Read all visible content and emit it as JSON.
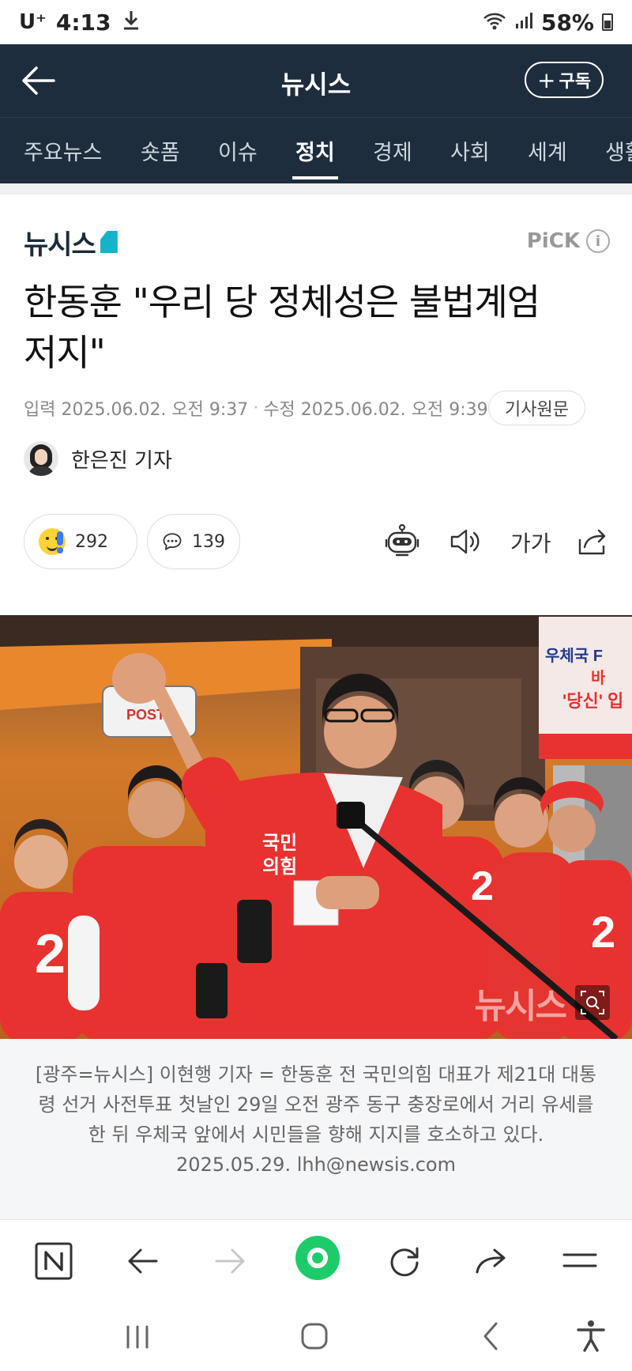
{
  "status": {
    "carrier": "U⁺",
    "time": "4:13",
    "battery": "58%"
  },
  "header": {
    "title": "뉴시스",
    "subscribe_label": "구독"
  },
  "tabs": [
    {
      "label": "주요뉴스",
      "active": false
    },
    {
      "label": "숏폼",
      "active": false
    },
    {
      "label": "이슈",
      "active": false
    },
    {
      "label": "정치",
      "active": true
    },
    {
      "label": "경제",
      "active": false
    },
    {
      "label": "사회",
      "active": false
    },
    {
      "label": "세계",
      "active": false
    },
    {
      "label": "생활",
      "active": false
    }
  ],
  "article": {
    "press_logo": "뉴시스",
    "pick_label": "PiCK",
    "headline_line1": "한동훈 \"우리 당 정체성은 불법계엄",
    "headline_line2": "저지\"",
    "input_date": "입력 2025.06.02. 오전 9:37",
    "edit_date": "수정 2025.06.02. 오전 9:39",
    "origin_button": "기사원문",
    "reporter": "한은진 기자",
    "reaction_count": "292",
    "comment_count": "139",
    "font_size_label": "가가",
    "photo_watermark": "뉴시스",
    "caption": "[광주=뉴시스] 이현행 기자 = 한동훈 전 국민의힘 대표가 제21대 대통령 선거 사전투표 첫날인 29일 오전 광주 동구 충장로에서 거리 유세를 한 뒤 우체국 앞에서 시민들을 향해 지지를 호소하고 있다. 2025.05.29. lhh@newsis.com"
  },
  "photo_text": {
    "banner1": "우체국 F",
    "banner2": "바",
    "banner3": "'당신' 입",
    "jersey": "국민\n의힘",
    "sign": "POST"
  },
  "colors": {
    "header_bg": "#1e2d3d",
    "accent_cyan": "#14b3c9",
    "party_red": "#e8322f",
    "browser_green": "#1ecb6b"
  }
}
